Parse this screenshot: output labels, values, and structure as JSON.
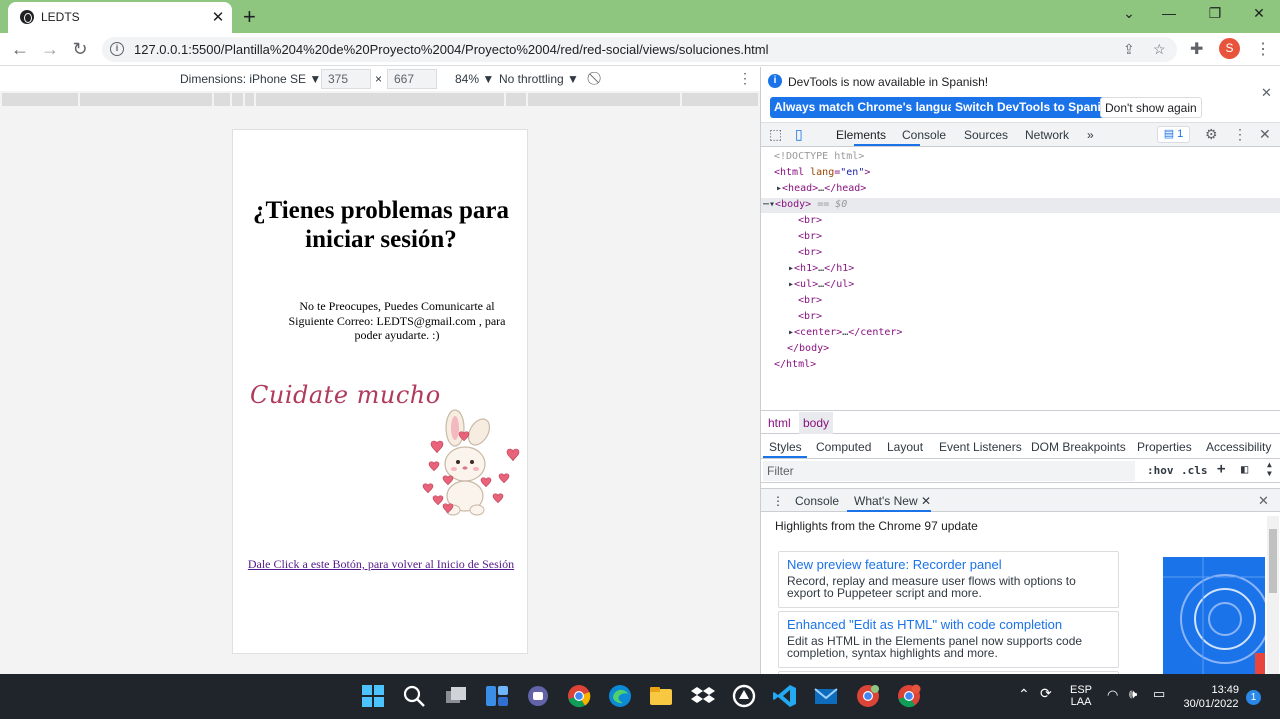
{
  "browser": {
    "tab_title": "LEDTS",
    "tab_close": "✕",
    "new_tab": "+",
    "url": "127.0.0.1:5500/Plantilla%204%20de%20Proyecto%2004/Proyecto%2004/red/red-social/views/soluciones.html",
    "profile_initial": "S"
  },
  "device_toolbar": {
    "dimensions_label": "Dimensions: iPhone SE ▼",
    "width": "375",
    "times": "×",
    "height": "667",
    "zoom": "84% ▼",
    "throttling": "No throttling ▼"
  },
  "page": {
    "heading": "¿Tienes problemas para iniciar sesión?",
    "message": "No te Preocupes, Puedes Comunicarte al Siguiente Correo: LEDTS@gmail.com , para poder ayudarte. :)",
    "decorative_text": "Cuidate mucho",
    "back_link": "Dale Click a este Botón, para volver al Inicio de Sesión"
  },
  "devtools": {
    "infobar_text": "DevTools is now available in Spanish!",
    "btn_match": "Always match Chrome's language",
    "btn_switch": "Switch DevTools to Spanish",
    "btn_dont_show": "Don't show again",
    "tabs": [
      "Elements",
      "Console",
      "Sources",
      "Network",
      "»"
    ],
    "issues_count": "1",
    "dom": {
      "doctype": "<!DOCTYPE html>",
      "body_suffix": " == $0"
    },
    "breadcrumbs": [
      "html",
      "body"
    ],
    "style_tabs": [
      "Styles",
      "Computed",
      "Layout",
      "Event Listeners",
      "DOM Breakpoints",
      "Properties",
      "Accessibility"
    ],
    "filter_placeholder": "Filter",
    "filter_hov": ":hov",
    "filter_cls": ".cls",
    "drawer_tabs": [
      "Console",
      "What's New"
    ],
    "whats_new_header": "Highlights from the Chrome 97 update",
    "cards": [
      {
        "title": "New preview feature: Recorder panel",
        "body": "Record, replay and measure user flows with options to export to Puppeteer script and more."
      },
      {
        "title": "Enhanced \"Edit as HTML\" with code completion",
        "body": "Edit as HTML in the Elements panel now supports code completion, syntax highlights and more."
      }
    ]
  },
  "taskbar": {
    "lang_top": "ESP",
    "lang_bottom": "LAA",
    "time": "13:49",
    "date": "30/01/2022",
    "notif_count": "1"
  },
  "colors": {
    "tab_strip": "#8ec67f",
    "accent": "#1a73e8",
    "taskbar": "#20252b"
  }
}
